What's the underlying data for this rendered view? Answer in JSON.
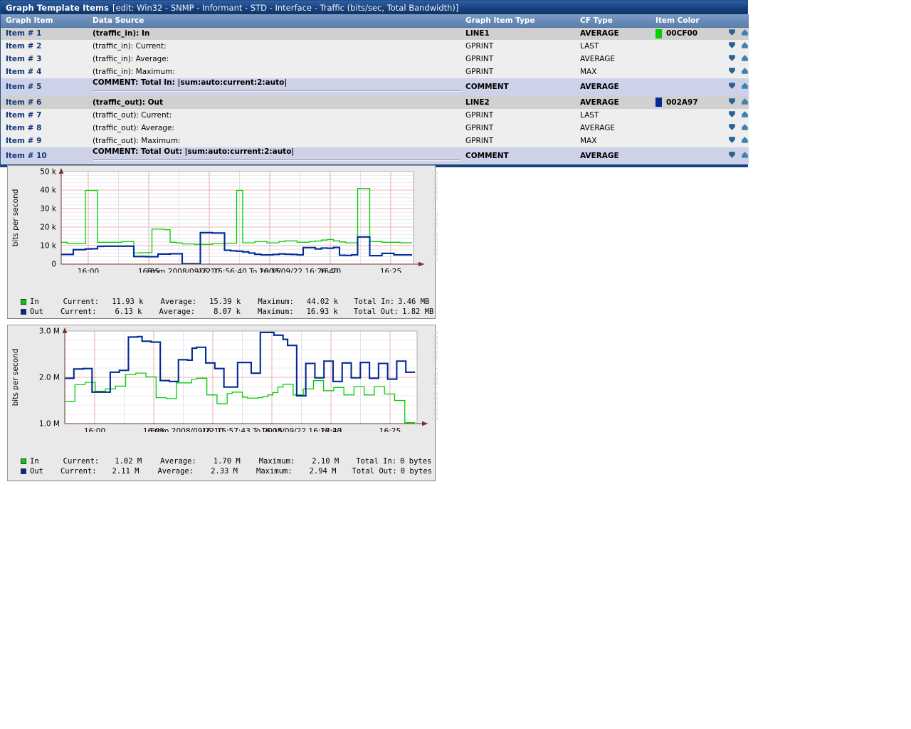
{
  "header": {
    "title": "Graph Template Items",
    "subtitle": "[edit: Win32 - SNMP - Informant - STD - Interface - Traffic (bits/sec, Total Bandwidth)]"
  },
  "table": {
    "columns": [
      "Graph Item",
      "Data Source",
      "Graph Item Type",
      "CF Type",
      "Item Color"
    ],
    "rows": [
      {
        "item": "Item # 1",
        "data_source": "(traffic_in): In",
        "prefix": "",
        "type": "LINE1",
        "cf": "AVERAGE",
        "color": "00CF00",
        "color_hex": "#00CF00",
        "style": "gray",
        "bold": true,
        "move_down": "move-down-icon",
        "move_up": "move-up-icon"
      },
      {
        "item": "Item # 2",
        "data_source": "(traffic_in): Current:",
        "prefix": "",
        "type": "GPRINT",
        "cf": "LAST",
        "color": "",
        "color_hex": "",
        "style": "light",
        "bold": false,
        "move_down": "move-down-icon",
        "move_up": "move-up-icon"
      },
      {
        "item": "Item # 3",
        "data_source": "(traffic_in): Average:",
        "prefix": "",
        "type": "GPRINT",
        "cf": "AVERAGE",
        "color": "",
        "color_hex": "",
        "style": "light",
        "bold": false,
        "move_down": "move-down-icon",
        "move_up": "move-up-icon"
      },
      {
        "item": "Item # 4",
        "data_source": "(traffic_in): Maximum:",
        "prefix": "",
        "type": "GPRINT",
        "cf": "MAX",
        "color": "",
        "color_hex": "",
        "style": "light",
        "bold": false,
        "move_down": "move-down-icon",
        "move_up": "move-up-icon"
      },
      {
        "item": "Item # 5",
        "data_source": "COMMENT: Total In: |sum:auto:current:2:auto|",
        "tag": "<HR>",
        "type": "COMMENT",
        "cf": "AVERAGE",
        "color": "",
        "color_hex": "",
        "style": "lav",
        "bold": true,
        "move_down": "move-down-icon",
        "move_up": "move-up-icon"
      },
      {
        "item": "Item # 6",
        "data_source": "(traffic_out): Out",
        "prefix": "",
        "type": "LINE2",
        "cf": "AVERAGE",
        "color": "002A97",
        "color_hex": "#002A97",
        "style": "gray",
        "bold": true,
        "move_down": "move-down-icon",
        "move_up": "move-up-icon"
      },
      {
        "item": "Item # 7",
        "data_source": "(traffic_out): Current:",
        "prefix": "",
        "type": "GPRINT",
        "cf": "LAST",
        "color": "",
        "color_hex": "",
        "style": "light",
        "bold": false,
        "move_down": "move-down-icon",
        "move_up": "move-up-icon"
      },
      {
        "item": "Item # 8",
        "data_source": "(traffic_out): Average:",
        "prefix": "",
        "type": "GPRINT",
        "cf": "AVERAGE",
        "color": "",
        "color_hex": "",
        "style": "light",
        "bold": false,
        "move_down": "move-down-icon",
        "move_up": "move-up-icon"
      },
      {
        "item": "Item # 9",
        "data_source": "(traffic_out): Maximum:",
        "prefix": "",
        "type": "GPRINT",
        "cf": "MAX",
        "color": "",
        "color_hex": "",
        "style": "light",
        "bold": false,
        "move_down": "move-down-icon",
        "move_up": "move-up-icon"
      },
      {
        "item": "Item # 10",
        "data_source": "COMMENT: Total Out: |sum:auto:current:2:auto|",
        "tag": "<HR>",
        "type": "COMMENT",
        "cf": "AVERAGE",
        "color": "",
        "color_hex": "",
        "style": "lav",
        "bold": true,
        "move_down": "move-down-icon",
        "move_up": "move-up-icon"
      }
    ]
  },
  "colors": {
    "title_bar": "#17427e",
    "column_header": "#6b8cb8",
    "link": "#10377a",
    "hr_tag": "#cc0000",
    "row_gray": "#d0d0d0",
    "row_light": "#eeeeee",
    "row_lavender": "#ced2e8",
    "series_in": "#00CF00",
    "series_out": "#002A97",
    "graph_bg": "#e9e9e9",
    "grid_major": "#e8a0a0",
    "grid_minor": "#d8d8e8"
  },
  "chart_data": [
    {
      "type": "line",
      "id": "graph-1",
      "title": "",
      "ylabel": "bits per second",
      "xlabel": "From 2008/09/22 15:56:40 To 2008/09/22 16:26:40",
      "time_range": {
        "from": "2008/09/22 15:56:40",
        "to": "2008/09/22 16:26:40"
      },
      "ylim": [
        0,
        50000
      ],
      "ytick_labels": [
        "0",
        "10 k",
        "20 k",
        "30 k",
        "40 k",
        "50 k"
      ],
      "ytick_values": [
        0,
        10000,
        20000,
        30000,
        40000,
        50000
      ],
      "xtick_labels": [
        "16:00",
        "16:05",
        "16:10",
        "16:15",
        "16:20",
        "16:25"
      ],
      "grid": true,
      "legend_position": "below",
      "watermark": "RRDTOOL / TOBI OETIKER",
      "series": [
        {
          "name": "In",
          "color": "#00CF00",
          "values": [
            11800,
            11000,
            11000,
            11000,
            39800,
            39800,
            11800,
            11800,
            11800,
            11800,
            12200,
            12200,
            6000,
            6200,
            6200,
            18900,
            18900,
            18600,
            11800,
            11500,
            10900,
            10900,
            10700,
            10700,
            10700,
            11000,
            11000,
            11200,
            11200,
            39800,
            11500,
            11500,
            12200,
            12200,
            11500,
            11500,
            12200,
            12600,
            12600,
            11800,
            11800,
            12200,
            12500,
            13000,
            13300,
            12600,
            12000,
            11500,
            11500,
            40900,
            40900,
            12200,
            12200,
            11800,
            11800,
            11800,
            11500,
            11500
          ],
          "stats": {
            "Current": "11.93 k",
            "Average": "15.39 k",
            "Maximum": "44.02 k",
            "Total In": "3.46 MB"
          }
        },
        {
          "name": "Out",
          "color": "#002A97",
          "values": [
            5200,
            5200,
            7800,
            7800,
            8200,
            8300,
            9600,
            9700,
            9700,
            9700,
            9700,
            9700,
            4100,
            4100,
            4000,
            4000,
            5400,
            5400,
            5600,
            5600,
            200,
            200,
            200,
            17000,
            17000,
            16800,
            16800,
            7500,
            7200,
            7000,
            6600,
            6000,
            5300,
            5000,
            5000,
            5200,
            5500,
            5300,
            5200,
            5000,
            8900,
            8900,
            8200,
            8700,
            8600,
            9000,
            4800,
            4700,
            5000,
            14700,
            14700,
            4600,
            4600,
            5800,
            5800,
            5000,
            5000,
            5000
          ],
          "stats": {
            "Current": "6.13 k",
            "Average": "8.07 k",
            "Maximum": "16.93 k",
            "Total Out": "1.82 MB"
          }
        }
      ],
      "legend_rows": [
        {
          "name": "In",
          "color": "#00CF00",
          "current_label": "Current:",
          "current": "11.93 k",
          "average_label": "Average:",
          "average": "15.39 k",
          "maximum_label": "Maximum:",
          "maximum": "44.02 k",
          "total_label": "Total In:",
          "total": "3.46 MB"
        },
        {
          "name": "Out",
          "color": "#002A97",
          "current_label": "Current:",
          "current": "6.13 k",
          "average_label": "Average:",
          "average": "8.07 k",
          "maximum_label": "Maximum:",
          "maximum": "16.93 k",
          "total_label": "Total Out:",
          "total": "1.82 MB"
        }
      ]
    },
    {
      "type": "line",
      "id": "graph-2",
      "title": "",
      "ylabel": "bits per second",
      "xlabel": "From 2008/09/22 15:57:43 To 2008/09/22 16:27:43",
      "time_range": {
        "from": "2008/09/22 15:57:43",
        "to": "2008/09/22 16:27:43"
      },
      "ylim": [
        1000000,
        3000000
      ],
      "ytick_labels": [
        "1.0 M",
        "2.0 M",
        "3.0 M"
      ],
      "ytick_values": [
        1000000,
        2000000,
        3000000
      ],
      "xtick_labels": [
        "16:00",
        "16:05",
        "16:10",
        "16:15",
        "16:20",
        "16:25"
      ],
      "grid": true,
      "legend_position": "below",
      "watermark": "RRDTOOL / TOBI OETIKER",
      "series": [
        {
          "name": "In",
          "color": "#00CF00",
          "values": [
            1480000,
            1480000,
            1840000,
            1840000,
            1890000,
            1890000,
            1700000,
            1700000,
            1750000,
            1750000,
            1810000,
            1810000,
            2060000,
            2060000,
            2090000,
            2090000,
            2010000,
            2010000,
            1560000,
            1560000,
            1540000,
            1540000,
            1880000,
            1880000,
            1880000,
            1960000,
            1980000,
            1980000,
            1620000,
            1620000,
            1430000,
            1430000,
            1650000,
            1680000,
            1680000,
            1570000,
            1550000,
            1550000,
            1560000,
            1580000,
            1620000,
            1670000,
            1790000,
            1850000,
            1850000,
            1620000,
            1620000,
            1750000,
            1750000,
            1930000,
            1930000,
            1710000,
            1710000,
            1780000,
            1780000,
            1620000,
            1620000,
            1800000,
            1800000,
            1620000,
            1620000,
            1800000,
            1800000,
            1640000,
            1640000,
            1500000,
            1500000,
            1020000,
            1020000
          ],
          "stats": {
            "Current": "1.02 M",
            "Average": "1.70 M",
            "Maximum": "2.10 M",
            "Total In": "0 bytes"
          }
        },
        {
          "name": "Out",
          "color": "#002A97",
          "values": [
            1980000,
            1980000,
            2180000,
            2180000,
            2190000,
            2190000,
            1680000,
            1680000,
            1680000,
            1680000,
            2110000,
            2110000,
            2150000,
            2150000,
            2870000,
            2870000,
            2880000,
            2780000,
            2780000,
            2760000,
            2760000,
            1930000,
            1930000,
            1910000,
            1910000,
            2380000,
            2380000,
            2370000,
            2630000,
            2650000,
            2650000,
            2310000,
            2310000,
            2190000,
            2190000,
            1790000,
            1790000,
            1790000,
            2320000,
            2320000,
            2320000,
            2090000,
            2090000,
            2970000,
            2970000,
            2970000,
            2910000,
            2910000,
            2820000,
            2690000,
            2690000,
            1600000,
            1600000,
            2300000,
            2300000,
            1990000,
            1990000,
            2350000,
            2350000,
            1910000,
            1910000,
            2310000,
            2310000,
            1990000,
            1990000,
            2320000,
            2320000,
            1980000,
            1980000,
            2300000,
            2300000,
            1960000,
            1960000,
            2350000,
            2350000,
            2110000,
            2110000
          ],
          "stats": {
            "Current": "2.11 M",
            "Average": "2.33 M",
            "Maximum": "2.94 M",
            "Total Out": "0 bytes"
          }
        }
      ],
      "legend_rows": [
        {
          "name": "In",
          "color": "#00CF00",
          "current_label": "Current:",
          "current": "1.02 M",
          "average_label": "Average:",
          "average": "1.70 M",
          "maximum_label": "Maximum:",
          "maximum": "2.10 M",
          "total_label": "Total In:",
          "total": "0 bytes"
        },
        {
          "name": "Out",
          "color": "#002A97",
          "current_label": "Current:",
          "current": "2.11 M",
          "average_label": "Average:",
          "average": "2.33 M",
          "maximum_label": "Maximum:",
          "maximum": "2.94 M",
          "total_label": "Total Out:",
          "total": "0 bytes"
        }
      ]
    }
  ]
}
